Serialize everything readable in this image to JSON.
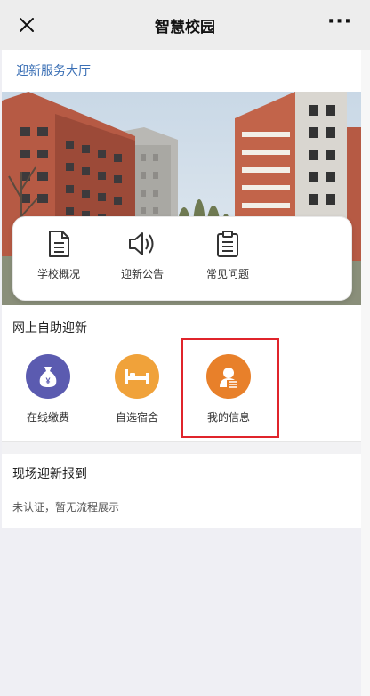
{
  "header": {
    "title": "智慧校园",
    "more_label": "···"
  },
  "hall_title": "迎新服务大厅",
  "quick_links": [
    {
      "label": "学校概况",
      "icon": "document-icon"
    },
    {
      "label": "迎新公告",
      "icon": "speaker-icon"
    },
    {
      "label": "常见问题",
      "icon": "clipboard-icon"
    }
  ],
  "self_service": {
    "title": "网上自助迎新",
    "items": [
      {
        "label": "在线缴费",
        "icon": "money-bag-icon",
        "color": "#5b5bb0"
      },
      {
        "label": "自选宿舍",
        "icon": "bed-icon",
        "color": "#f0a23a"
      },
      {
        "label": "我的信息",
        "icon": "user-card-icon",
        "color": "#e8802a"
      }
    ],
    "highlight_color": "#e0242b"
  },
  "onsite": {
    "title": "现场迎新报到",
    "status": "未认证，暂无流程展示"
  },
  "colors": {
    "link_blue": "#3a6fb5",
    "topbar_bg": "#ededed"
  }
}
